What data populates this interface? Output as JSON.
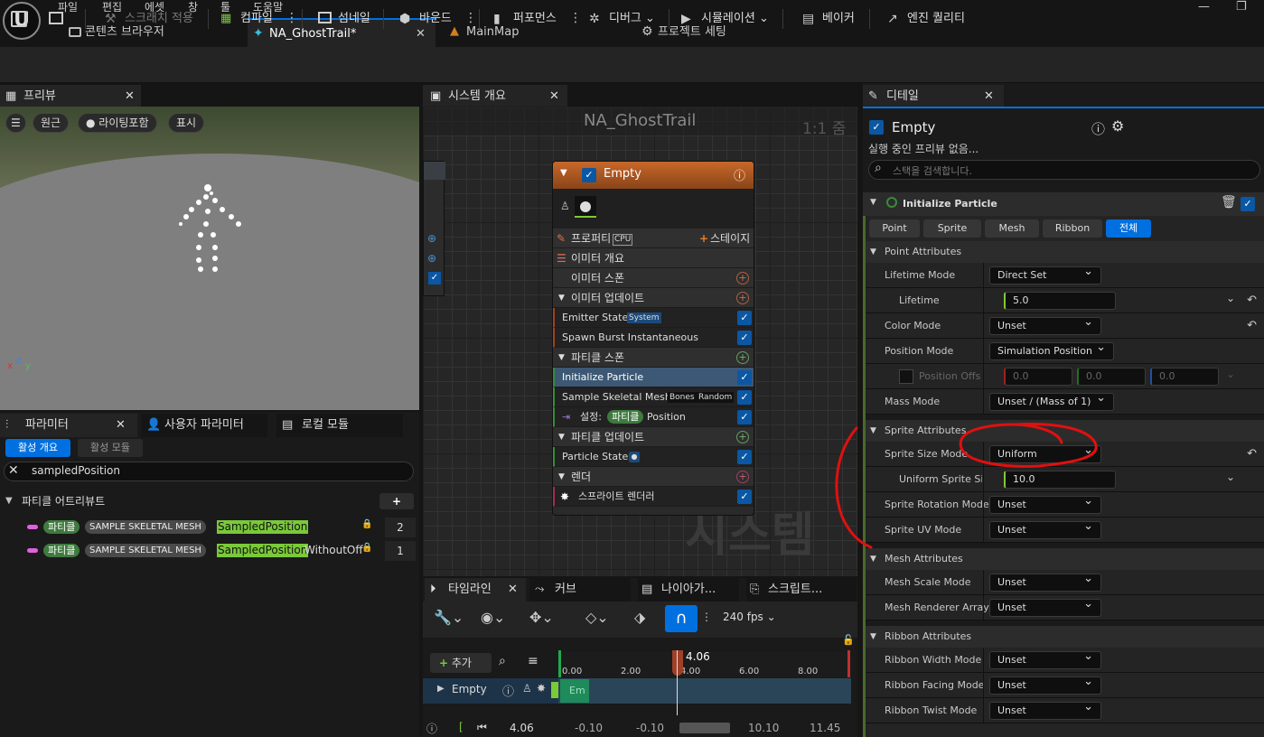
{
  "menu": [
    "파일",
    "편집",
    "에셋",
    "창",
    "툴",
    "도움말"
  ],
  "tabs": {
    "content_browser": "콘텐츠 브라우저",
    "ghost_trail": "NA_GhostTrail*",
    "main_map": "MainMap",
    "project_settings": "프로젝트 세팅"
  },
  "toolbar": {
    "apply_scratch": "스크래치 적용",
    "compile": "컴파일",
    "thumbnail": "섬네일",
    "bounds": "바운드",
    "performance": "퍼포먼스",
    "debug": "디버그",
    "simulation": "시뮬레이션",
    "baker": "베이커",
    "engine_quality": "엔진 퀄리티"
  },
  "preview": {
    "tab": "프리뷰",
    "perspective": "원근",
    "lighting": "라이팅포함",
    "show": "표시"
  },
  "params": {
    "tab_params": "파라미터",
    "tab_user_params": "사용자 파라미터",
    "tab_local_modules": "로컬 모듈",
    "active_overview": "활성 개요",
    "active_modules": "활성 모듈",
    "search_value": "sampledPosition",
    "section": "파티클 어트리뷰트",
    "rows": [
      {
        "scope": "파티클",
        "module": "SAMPLE SKELETAL MESH",
        "hl": "SampledPosition",
        "rest": "",
        "count": "2"
      },
      {
        "scope": "파티클",
        "module": "SAMPLE SKELETAL MESH",
        "hl": "SampledPosition",
        "rest": "WithoutOff",
        "count": "1"
      }
    ]
  },
  "graph": {
    "tab": "시스템 개요",
    "title": "NA_GhostTrail",
    "zoom": "1:1 줌",
    "watermark": "시스템"
  },
  "node": {
    "title": "Empty",
    "properties": "프로퍼티",
    "cpu": "CPU",
    "stage": "스테이지",
    "emitter_summary": "이미터 개요",
    "emitter_spawn": "이미터 스폰",
    "emitter_update": "이미터 업데이트",
    "emitter_state": "Emitter State",
    "system_tag": "System",
    "spawn_burst": "Spawn Burst Instantaneous",
    "particle_spawn": "파티클 스폰",
    "init_particle": "Initialize Particle",
    "sample_skel": "Sample Skeletal Mesh",
    "bones": "Bones",
    "random": "Random",
    "set_label": "설정:",
    "set_scope": "파티클",
    "set_value": "Position",
    "particle_update": "파티클 업데이트",
    "particle_state": "Particle State",
    "render": "렌더",
    "sprite_renderer": "스프라이트 렌더러"
  },
  "timeline": {
    "tab_timeline": "타임라인",
    "tab_curve": "커브",
    "tab_niagara": "나이아가...",
    "tab_script": "스크립트...",
    "fps": "240 fps",
    "add": "추가",
    "playhead": "4.06",
    "ticks": [
      "0.00",
      "2.00",
      "4.00",
      "6.00",
      "8.00"
    ],
    "track": "Empty",
    "clip": "Em",
    "time": "4.06",
    "range": [
      "-0.10",
      "-0.10",
      "10.10",
      "11.45"
    ]
  },
  "details": {
    "tab": "디테일",
    "name": "Empty",
    "no_preview": "실행 중인 프리뷰 없음...",
    "search_placeholder": "스택을 검색합니다.",
    "module": "Initialize Particle",
    "filters": [
      "Point",
      "Sprite",
      "Mesh",
      "Ribbon",
      "전체"
    ],
    "cat_point": "Point Attributes",
    "lifetime_mode": "Lifetime Mode",
    "lifetime_mode_val": "Direct Set",
    "lifetime": "Lifetime",
    "lifetime_val": "5.0",
    "color_mode": "Color Mode",
    "color_mode_val": "Unset",
    "position_mode": "Position Mode",
    "position_mode_val": "Simulation Position",
    "position_offset": "Position Offs",
    "position_offset_vals": [
      "0.0",
      "0.0",
      "0.0"
    ],
    "mass_mode": "Mass Mode",
    "mass_mode_val": "Unset / (Mass of 1)",
    "cat_sprite": "Sprite Attributes",
    "sprite_size_mode": "Sprite Size Mode",
    "sprite_size_mode_val": "Uniform",
    "uniform_sprite_size": "Uniform Sprite Siz",
    "uniform_sprite_size_val": "10.0",
    "sprite_rotation_mode": "Sprite Rotation Mode",
    "sprite_rotation_mode_val": "Unset",
    "sprite_uv_mode": "Sprite UV Mode",
    "sprite_uv_mode_val": "Unset",
    "cat_mesh": "Mesh Attributes",
    "mesh_scale_mode": "Mesh Scale Mode",
    "mesh_scale_mode_val": "Unset",
    "mesh_renderer_array": "Mesh Renderer Array",
    "mesh_renderer_array_val": "Unset",
    "cat_ribbon": "Ribbon Attributes",
    "ribbon_width_mode": "Ribbon Width Mode",
    "ribbon_width_mode_val": "Unset",
    "ribbon_facing_mode": "Ribbon Facing Mode",
    "ribbon_facing_mode_val": "Unset",
    "ribbon_twist_mode": "Ribbon Twist Mode",
    "ribbon_twist_mode_val": "Unset"
  },
  "colors": {
    "accent": "#0070e0",
    "green": "#7ac93a",
    "node_header": "#b05a1e",
    "annotation": "#e01010"
  }
}
